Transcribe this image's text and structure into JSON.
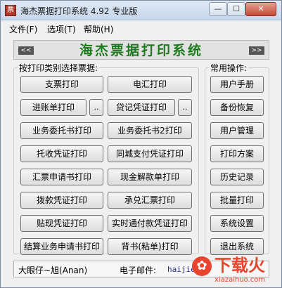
{
  "window": {
    "title": "海杰票据打印系统 4.92 专业版",
    "controls": {
      "minimize": "—",
      "maximize": "☐",
      "close": "✕"
    }
  },
  "menu": [
    "文件(F)",
    "选项(T)",
    "帮助(H)"
  ],
  "banner": {
    "title": "海杰票据打印系统",
    "left_arrow": "<<",
    "right_arrow": ">>"
  },
  "left_group": {
    "label": "按打印类别选择票据:",
    "buttons": [
      "支票打印",
      "电汇打印",
      "进账单打印",
      "..",
      "贷记凭证打印",
      "..",
      "业务委托书打印",
      "业务委托书2打印",
      "托收凭证打印",
      "同城支付凭证打印",
      "汇票申请书打印",
      "现金解款单打印",
      "拨款凭证打印",
      "承兑汇票打印",
      "贴现凭证打印",
      "实时通付款凭证打印",
      "结算业务申请书打印",
      "背书(粘单)打印"
    ]
  },
  "right_group": {
    "label": "常用操作:",
    "buttons": [
      "用户手册",
      "备份恢复",
      "用户管理",
      "打印方案",
      "历史记录",
      "批量打印",
      "系统设置",
      "退出系统"
    ]
  },
  "status": {
    "author": "大眼仔~旭(Anan)",
    "email_label": "电子邮件:",
    "email": "haijie30"
  },
  "watermark": {
    "icon": "✿",
    "brand": "下载火",
    "url": "xiazaihuo.com"
  },
  "colors": {
    "title_green": "#1f7a1f",
    "watermark_red": "#e8442e"
  }
}
